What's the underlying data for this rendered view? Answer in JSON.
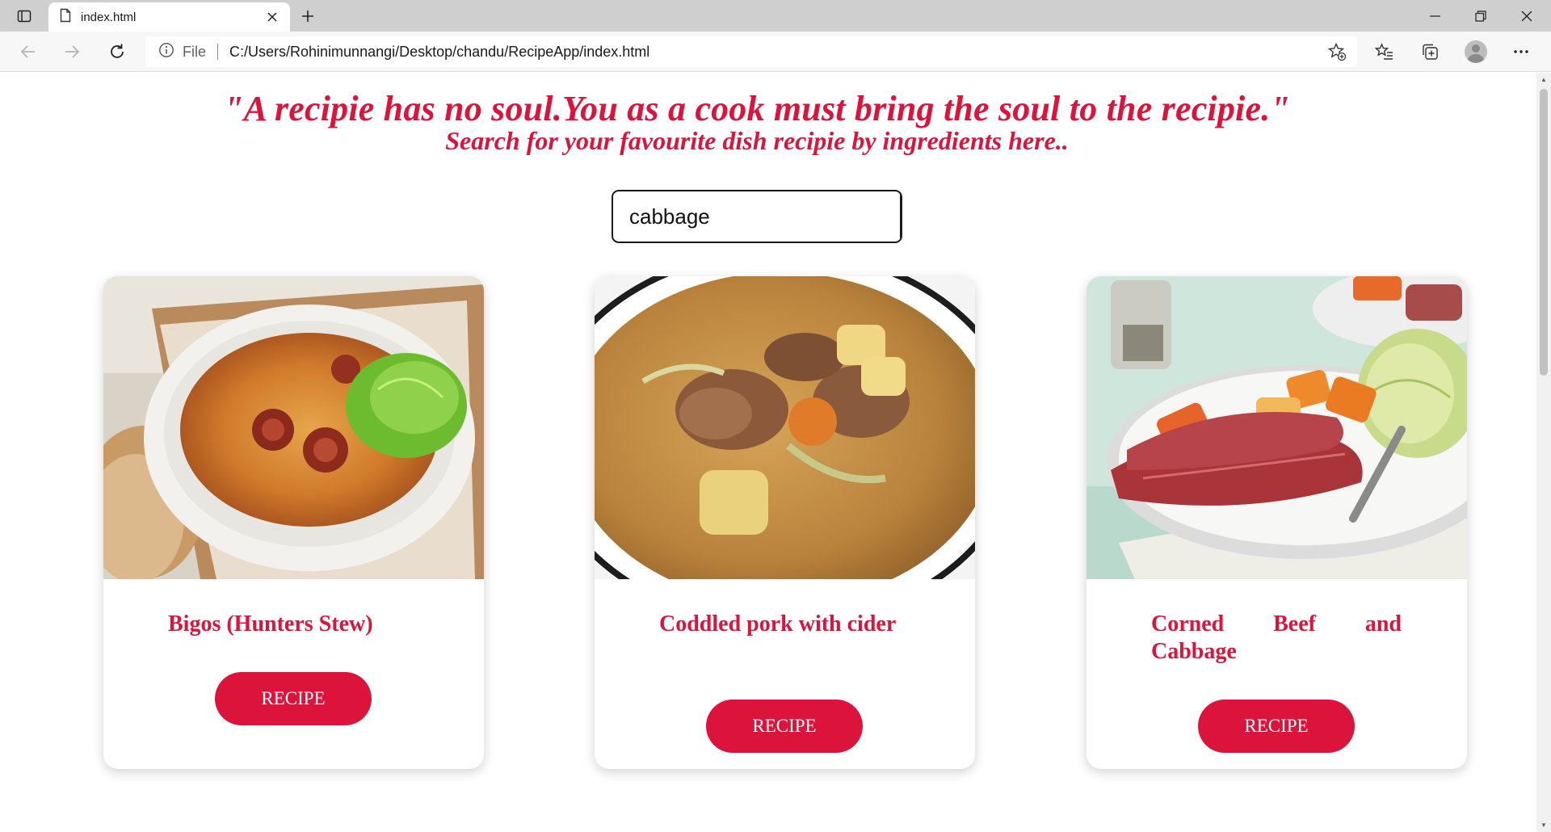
{
  "browser": {
    "tab_title": "index.html",
    "address_prefix": "File",
    "url": "C:/Users/Rohinimunnangi/Desktop/chandu/RecipeApp/index.html"
  },
  "page": {
    "quote": "\"A recipie has no soul.You as a cook must bring the soul to the recipie.\"",
    "subtitle": "Search for your favourite dish recipie by ingredients here..",
    "search": {
      "value": "cabbage",
      "button_icon": "search-icon"
    },
    "accent_color": "#dc143c",
    "cards": [
      {
        "title": "Bigos (Hunters Stew)",
        "button_label": "RECIPE",
        "image": "cabbage stew with sausage in bowl with bread"
      },
      {
        "title": "Coddled pork with cider",
        "button_label": "RECIPE",
        "image": "pork and potato stew in bowl"
      },
      {
        "title": "Corned Beef and Cabbage",
        "button_label": "RECIPE",
        "image": "sliced corned beef with carrots and cabbage on plate"
      }
    ]
  }
}
